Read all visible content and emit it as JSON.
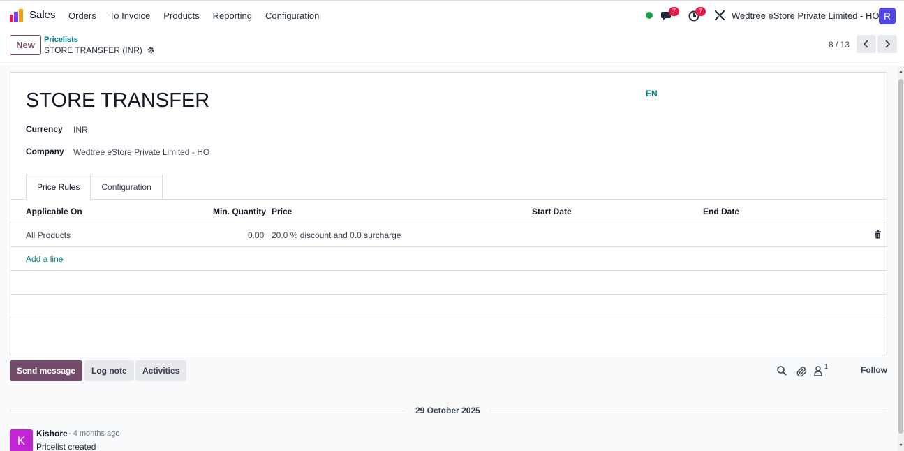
{
  "app": {
    "name": "Sales"
  },
  "menu": [
    "Orders",
    "To Invoice",
    "Products",
    "Reporting",
    "Configuration"
  ],
  "navbar": {
    "messages_badge": "7",
    "activities_badge": "7",
    "company": "Wedtree eStore Private Limited - HO",
    "user_initial": "R",
    "status_color": "#16a34a"
  },
  "control": {
    "new_label": "New",
    "breadcrumb_parent": "Pricelists",
    "breadcrumb_current": "STORE TRANSFER (INR)",
    "pager": "8 / 13"
  },
  "record": {
    "title": "STORE TRANSFER",
    "lang": "EN",
    "currency_label": "Currency",
    "currency_value": "INR",
    "company_label": "Company",
    "company_value": "Wedtree eStore Private Limited - HO"
  },
  "tabs": [
    "Price Rules",
    "Configuration"
  ],
  "table": {
    "headers": [
      "Applicable On",
      "Min. Quantity",
      "Price",
      "Start Date",
      "End Date"
    ],
    "rows": [
      {
        "applicable_on": "All Products",
        "min_qty": "0.00",
        "price": "20.0 % discount and 0.0 surcharge",
        "start": "",
        "end": ""
      }
    ],
    "add_line": "Add a line"
  },
  "chatter": {
    "send_message": "Send message",
    "log_note": "Log note",
    "activities": "Activities",
    "followers_count": "1",
    "follow": "Follow",
    "date": "29 October 2025",
    "message": {
      "avatar_initial": "K",
      "author": "Kishore",
      "time": "- 4 months ago",
      "body": "Pricelist created"
    }
  },
  "colors": {
    "brand": "#714b67",
    "link": "#017e84",
    "badge": "#e11d48"
  }
}
